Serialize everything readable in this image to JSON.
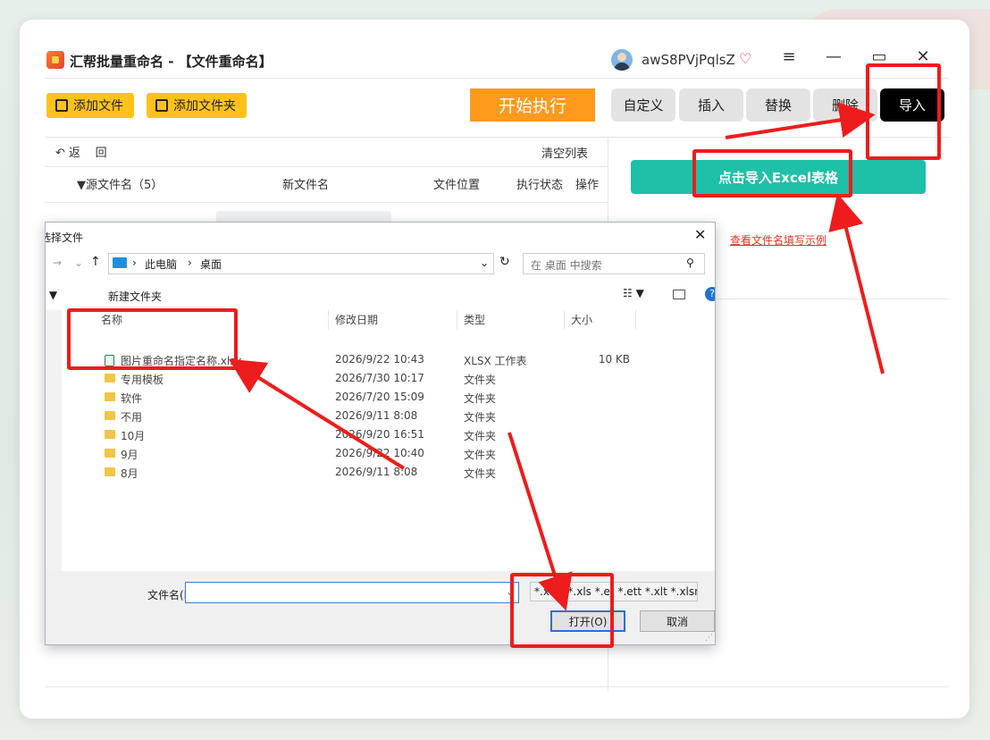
{
  "app": {
    "title": "汇帮批量重命名 - 【文件重命名】",
    "username": "awS8PVjPqlsZ",
    "vip_icon": "♡",
    "min": "—",
    "max": "▭",
    "menu": "≡",
    "close": "✕"
  },
  "toolbar": {
    "add_file": "添加文件",
    "add_folder": "添加文件夹",
    "start": "开始执行"
  },
  "tabs": [
    "自定义",
    "插入",
    "替换",
    "删除",
    "导入"
  ],
  "list": {
    "back": "返",
    "back2": "回",
    "clear": "清空列表",
    "headers": {
      "source": "源文件名（5）",
      "new": "新文件名",
      "location": "文件位置",
      "status": "执行状态",
      "action": "操作"
    }
  },
  "import_panel": {
    "button": "点击导入Excel表格",
    "example_link": "查看文件名填写示例"
  },
  "dialog": {
    "title": "选择文件",
    "crumb": [
      "此电脑",
      "桌面"
    ],
    "search_placeholder": "在 桌面 中搜索",
    "new_folder": "新建文件夹",
    "columns": [
      "名称",
      "修改日期",
      "类型",
      "大小"
    ],
    "files": [
      {
        "name": "图片重命名指定名称.xlsx",
        "date": "2026/9/22 10:43",
        "type": "XLSX 工作表",
        "size": "10 KB",
        "icon": "xlsx"
      },
      {
        "name": "专用模板",
        "date": "2026/7/30 10:17",
        "type": "文件夹",
        "size": "",
        "icon": "folder"
      },
      {
        "name": "软件",
        "date": "2026/7/20 15:09",
        "type": "文件夹",
        "size": "",
        "icon": "folder"
      },
      {
        "name": "不用",
        "date": "2026/9/11 8:08",
        "type": "文件夹",
        "size": "",
        "icon": "folder"
      },
      {
        "name": "10月",
        "date": "2026/9/20 16:51",
        "type": "文件夹",
        "size": "",
        "icon": "folder"
      },
      {
        "name": "9月",
        "date": "2026/9/22 10:40",
        "type": "文件夹",
        "size": "",
        "icon": "folder"
      },
      {
        "name": "8月",
        "date": "2026/9/11 8:08",
        "type": "文件夹",
        "size": "",
        "icon": "folder"
      }
    ],
    "filename_label": "文件名(N):",
    "filename_value": "",
    "filetype": "*.xlsx *.xls *.et *.ett *.xlt *.xlsn",
    "open": "打开(O)",
    "cancel": "取消"
  }
}
